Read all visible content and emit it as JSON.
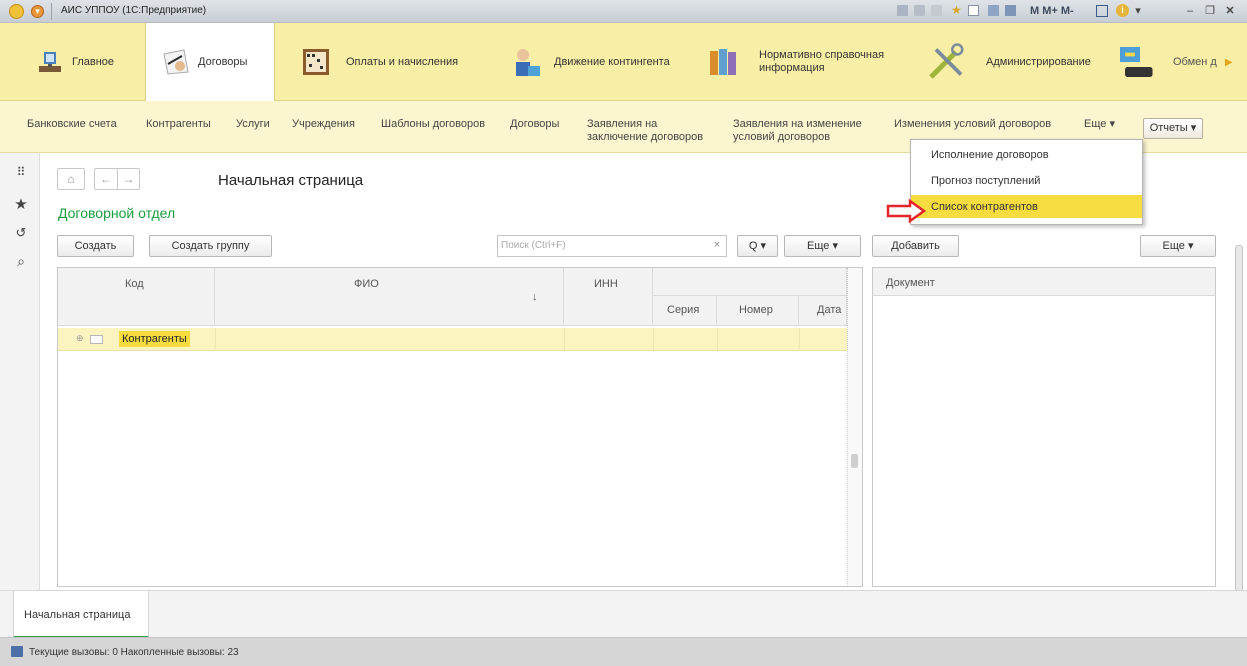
{
  "window": {
    "title": "АИС УППОУ (1С:Предприятие)",
    "toolbar_text": "M  M+  M-"
  },
  "sections": [
    {
      "label": "Главное",
      "icon": "home-desk-icon"
    },
    {
      "label": "Договоры",
      "icon": "contract-signing-icon"
    },
    {
      "label": "Оплаты и начисления",
      "icon": "abacus-icon"
    },
    {
      "label": "Движение контингента",
      "icon": "people-icon"
    },
    {
      "label": "Нормативно справочная информация",
      "icon": "books-icon"
    },
    {
      "label": "Администрирование",
      "icon": "tools-icon"
    },
    {
      "label": "Обмен д",
      "icon": "exchange-icon"
    }
  ],
  "commands": {
    "items": [
      "Банковские счета",
      "Контрагенты",
      "Услуги",
      "Учреждения",
      "Шаблоны договоров",
      "Договоры"
    ],
    "applications_conclusion": [
      "Заявления на",
      "заключение договоров"
    ],
    "applications_change": [
      "Заявления на изменение",
      "условий договоров"
    ],
    "changes_conditions": "Изменения условий договоров",
    "more": "Еще ▾",
    "reports": "Отчеты ▾"
  },
  "reports_menu": [
    "Исполнение договоров",
    "Прогноз поступлений",
    "Список контрагентов"
  ],
  "page": {
    "title": "Начальная страница",
    "department": "Договорной отдел"
  },
  "list_toolbar": {
    "create": "Создать",
    "create_group": "Создать группу",
    "search_placeholder": "Поиск (Ctrl+F)",
    "clear": "×",
    "search_btn": "Q ▾",
    "more": "Еще  ▾",
    "add": "Добавить",
    "more_right": "Еще  ▾"
  },
  "grid": {
    "columns": {
      "code": "Код",
      "fio": "ФИО",
      "inn": "ИНН",
      "series": "Серия",
      "number": "Номер",
      "date": "Дата"
    },
    "sort_indicator": "↓",
    "rows": [
      {
        "code": "Контрагенты"
      }
    ]
  },
  "right_pane": {
    "column": "Документ"
  },
  "bottom": {
    "tab": "Начальная страница",
    "status": "Текущие вызовы: 0   Накопленные вызовы: 23"
  }
}
